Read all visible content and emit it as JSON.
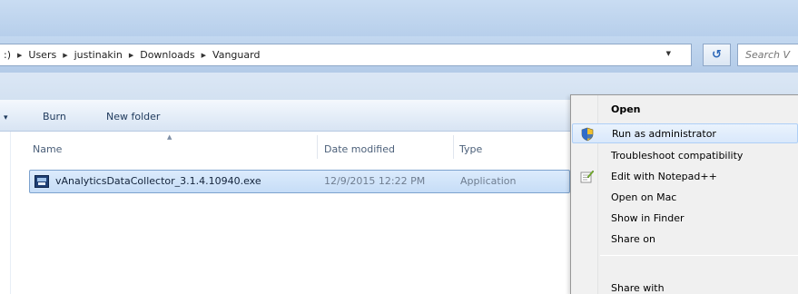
{
  "breadcrumb": {
    "items": [
      ":)",
      "Users",
      "justinakin",
      "Downloads",
      "Vanguard"
    ]
  },
  "search": {
    "placeholder": "Search V"
  },
  "toolbar": {
    "burn_label": "Burn",
    "new_folder_label": "New folder"
  },
  "columns": {
    "name": "Name",
    "date_modified": "Date modified",
    "type": "Type"
  },
  "files": [
    {
      "name": "vAnalyticsDataCollector_3.1.4.10940.exe",
      "date_modified": "12/9/2015 12:22 PM",
      "type": "Application",
      "icon": "exe-file-icon"
    }
  ],
  "context_menu": {
    "items": [
      {
        "label": "Open",
        "bold": true
      },
      {
        "label": "Run as administrator",
        "icon": "uac-shield-icon",
        "highlighted": true
      },
      {
        "label": "Troubleshoot compatibility"
      },
      {
        "label": "Edit with Notepad++",
        "icon": "notepad-plus-plus-icon"
      },
      {
        "label": "Open on Mac"
      },
      {
        "label": "Show in Finder"
      },
      {
        "label": "Share on"
      },
      {
        "label": "Share with"
      }
    ]
  },
  "colors": {
    "selection_fill": "#c6ddf7",
    "selection_border": "#7da2ce",
    "menu_highlight": "#d9e8fb",
    "chrome_blue": "#c3d8f0"
  }
}
